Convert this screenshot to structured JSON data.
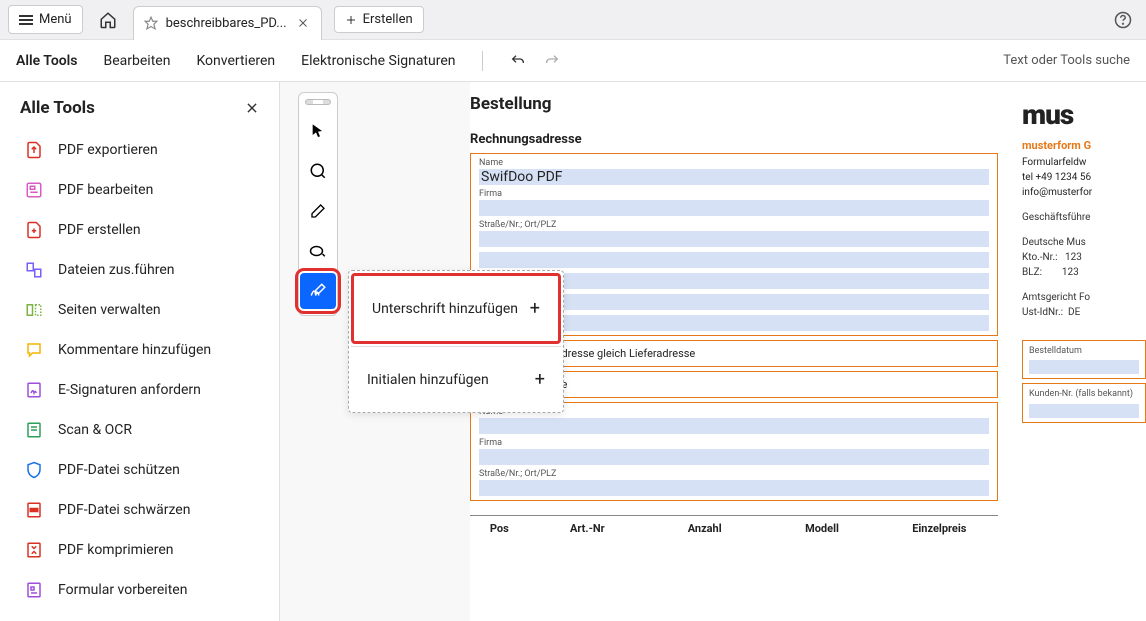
{
  "topbar": {
    "menu_label": "Menü",
    "tab_title": "beschreibbares_PD...",
    "create_label": "Erstellen"
  },
  "menubar": {
    "items": [
      "Alle Tools",
      "Bearbeiten",
      "Konvertieren",
      "Elektronische Signaturen"
    ],
    "search_placeholder": "Text oder Tools suche"
  },
  "sidebar": {
    "title": "Alle Tools",
    "tools": [
      {
        "icon": "export-icon",
        "label": "PDF exportieren",
        "color": "#d93025"
      },
      {
        "icon": "edit-icon",
        "label": "PDF bearbeiten",
        "color": "#d85bc4"
      },
      {
        "icon": "create-icon",
        "label": "PDF erstellen",
        "color": "#d93025"
      },
      {
        "icon": "combine-icon",
        "label": "Dateien zus.führen",
        "color": "#7a5cff"
      },
      {
        "icon": "pages-icon",
        "label": "Seiten verwalten",
        "color": "#7cb342"
      },
      {
        "icon": "comment-icon",
        "label": "Kommentare hinzufügen",
        "color": "#f5b400"
      },
      {
        "icon": "esign-icon",
        "label": "E-Signaturen anfordern",
        "color": "#9d4edd"
      },
      {
        "icon": "scan-icon",
        "label": "Scan & OCR",
        "color": "#2e9e5b"
      },
      {
        "icon": "protect-icon",
        "label": "PDF-Datei schützen",
        "color": "#1a73e8"
      },
      {
        "icon": "redact-icon",
        "label": "PDF-Datei schwärzen",
        "color": "#d93025"
      },
      {
        "icon": "compress-icon",
        "label": "PDF komprimieren",
        "color": "#d93025"
      },
      {
        "icon": "form-icon",
        "label": "Formular vorbereiten",
        "color": "#9d4edd"
      }
    ]
  },
  "sig_popup": {
    "add_signature": "Unterschrift hinzufügen",
    "add_initials": "Initialen hinzufügen"
  },
  "pdf": {
    "title": "Bestellung",
    "section1": "Rechnungsadresse",
    "fields": {
      "name_label": "Name",
      "name_value": "SwifDoo PDF",
      "firma_label": "Firma",
      "street_label": "Straße/Nr.; Ort/PLZ",
      "name2_label": "Name",
      "firma2_label": "Firma",
      "street2_label": "Straße/Nr.; Ort/PLZ"
    },
    "chk1": "Rechnungsadresse gleich Lieferadresse",
    "chk2": "Lieferadresse",
    "side": {
      "bestelldatum": "Bestelldatum",
      "kundennr": "Kunden-Nr. (falls bekannt)"
    },
    "table_headers": [
      "Pos",
      "Art.-Nr",
      "Anzahl",
      "Modell",
      "Einzelpreis"
    ],
    "company": {
      "logo": "mus",
      "name": "musterform G",
      "addr1": "Formularfeldw",
      "tel": "tel +49 1234 56",
      "email": "info@musterfor",
      "gf": "Geschäftsführe",
      "bank": "Deutsche Mus",
      "kto_label": "Kto.-Nr.:",
      "kto": "123",
      "blz_label": "BLZ:",
      "blz": "123",
      "court": "Amtsgericht Fo",
      "ust_label": "Ust-IdNr.:",
      "ust": "DE "
    }
  }
}
